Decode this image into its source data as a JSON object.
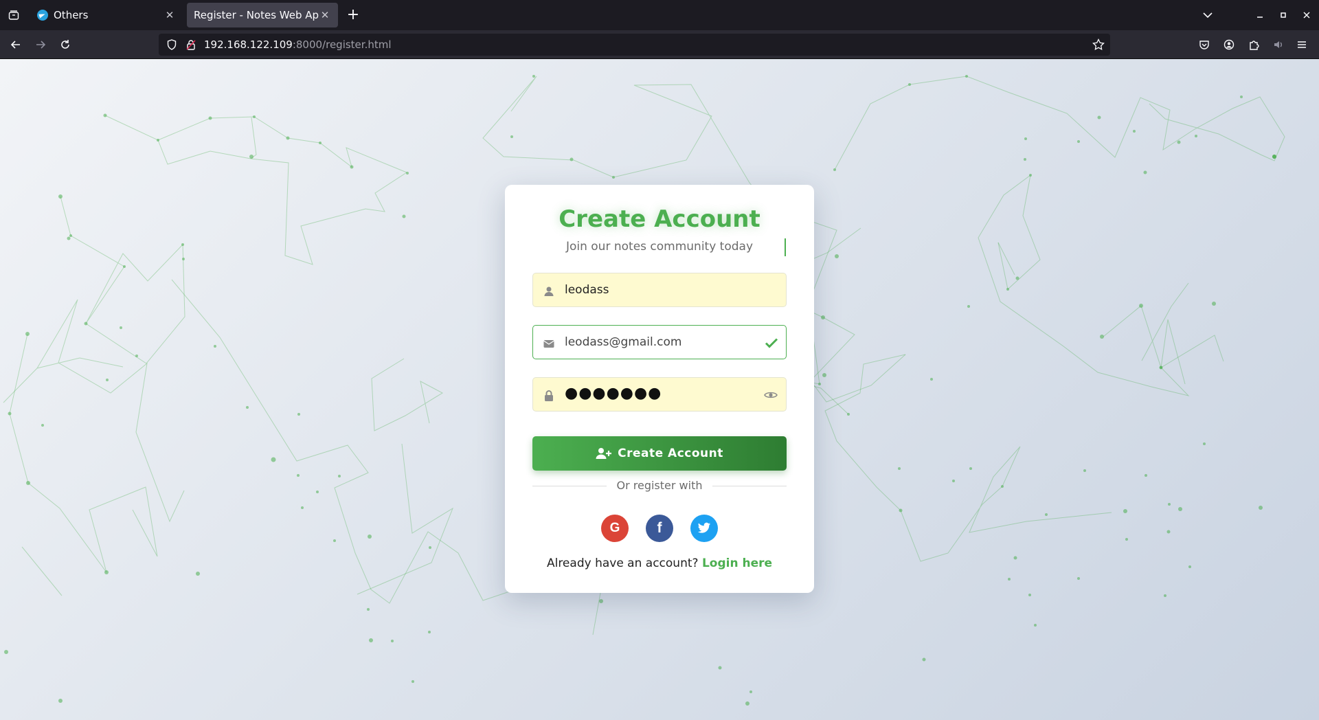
{
  "browser": {
    "tabs": [
      {
        "title": "Others",
        "active": false
      },
      {
        "title": "Register - Notes Web App",
        "active": true
      }
    ],
    "url_host": "192.168.122.109",
    "url_rest": ":8000/register.html"
  },
  "form": {
    "title": "Create Account",
    "subtitle": "Join our notes community today",
    "username_value": "leodass",
    "email_value": "leodass@gmail.com",
    "password_masked": "●●●●●●●",
    "submit_label": "Create Account",
    "divider_text": "Or register with",
    "login_prompt": "Already have an account?",
    "login_link": "Login here"
  },
  "social": {
    "google": "G",
    "facebook": "f"
  },
  "colors": {
    "accent": "#4caf50",
    "accent_dark": "#2e7d32",
    "google": "#db4437",
    "facebook": "#3b5998",
    "twitter": "#1da1f2",
    "autofill": "#fefad0"
  },
  "icons": [
    "user-icon",
    "envelope-icon",
    "check-icon",
    "lock-icon",
    "eye-icon",
    "user-plus-icon",
    "google-icon",
    "facebook-icon",
    "twitter-icon"
  ]
}
